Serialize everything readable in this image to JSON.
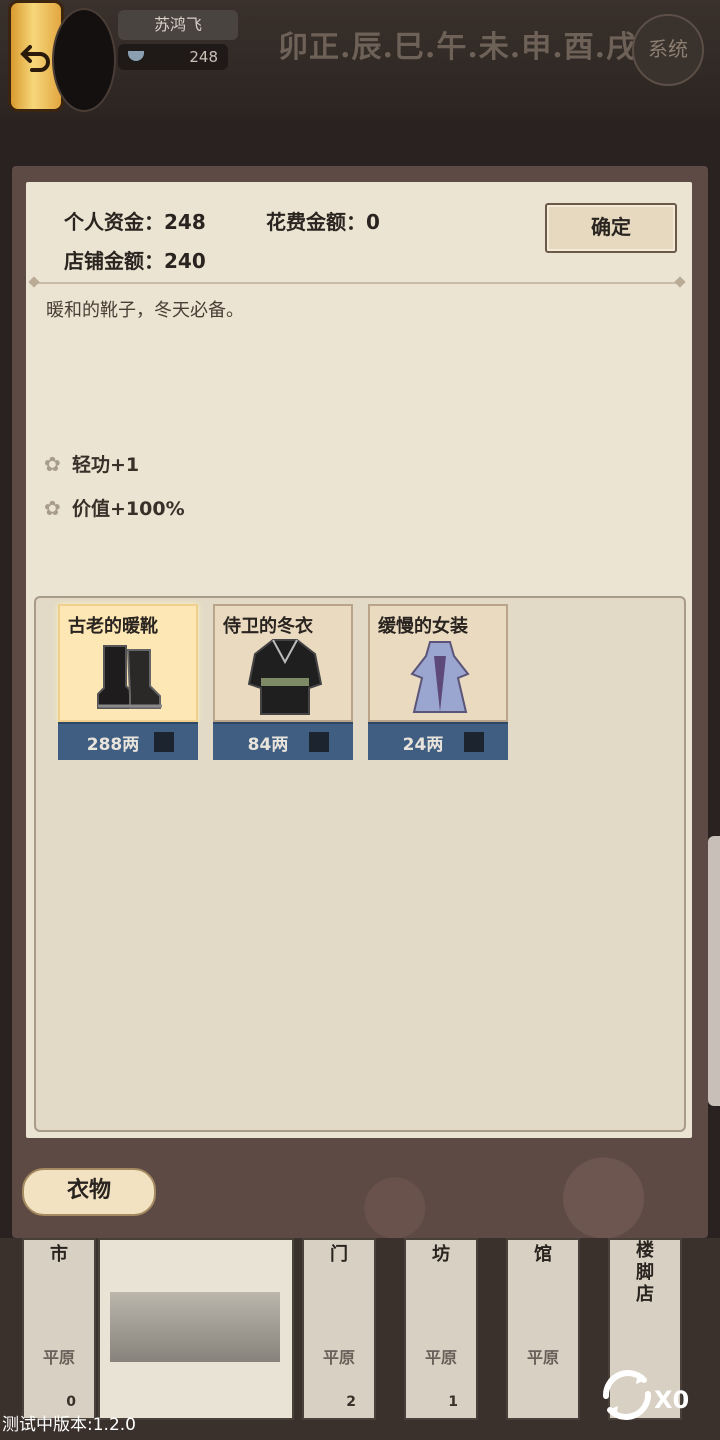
{
  "header": {
    "player_name": "苏鸿飞",
    "coins": "248",
    "time_title": "卯正.辰.巳.午.未.申.酉.戌",
    "system_label": "系统"
  },
  "panel": {
    "personal_funds": "个人资金：248",
    "cost_amount": "花费金额：0",
    "shop_funds": "店铺金额：240",
    "confirm_label": "确定",
    "description": "暖和的靴子，冬天必备。",
    "attributes": [
      "轻功+1",
      "价值+100%"
    ],
    "items": [
      {
        "name": "古老的暖靴",
        "price": "288两",
        "selected": true
      },
      {
        "name": "侍卫的冬衣",
        "price": "84两",
        "selected": false
      },
      {
        "name": "缓慢的女装",
        "price": "24两",
        "selected": false
      }
    ],
    "tab_label": "衣物"
  },
  "street": {
    "shops": [
      {
        "name": "市",
        "terrain": "平原",
        "count": "0"
      },
      {
        "name": "门",
        "terrain": "平原",
        "count": "2"
      },
      {
        "name": "坊",
        "terrain": "平原",
        "count": "1"
      },
      {
        "name": "馆",
        "terrain": "平原",
        "count": ""
      },
      {
        "name": "楼脚店",
        "terrain": "",
        "count": ""
      }
    ],
    "refresh_count": "X0",
    "version": "测试中版本:1.2.0"
  },
  "colors": {
    "paper": "#ece4d2",
    "frame": "#5e4a44",
    "price_bar": "#3f5e82",
    "selected_card": "#fde7b5"
  }
}
